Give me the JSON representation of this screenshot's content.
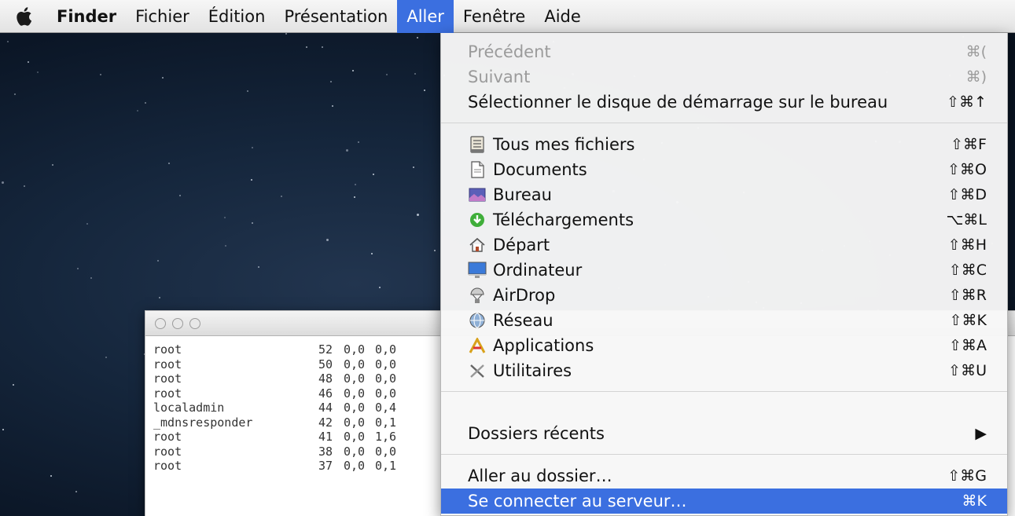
{
  "menubar": {
    "app_name": "Finder",
    "items": [
      "Fichier",
      "Édition",
      "Présentation",
      "Aller",
      "Fenêtre",
      "Aide"
    ],
    "active_item": "Aller"
  },
  "dropdown": {
    "items": [
      {
        "label": "Précédent",
        "shortcut": "⌘(",
        "disabled": true
      },
      {
        "label": "Suivant",
        "shortcut": "⌘)",
        "disabled": true
      },
      {
        "label": "Sélectionner le disque de démarrage sur le bureau",
        "shortcut": "⇧⌘↑",
        "disabled": false
      },
      {
        "label": "Tous mes fichiers",
        "shortcut": "⇧⌘F",
        "icon": "all-files-icon"
      },
      {
        "label": "Documents",
        "shortcut": "⇧⌘O",
        "icon": "document-icon"
      },
      {
        "label": "Bureau",
        "shortcut": "⇧⌘D",
        "icon": "desktop-icon"
      },
      {
        "label": "Téléchargements",
        "shortcut": "⌥⌘L",
        "icon": "download-icon"
      },
      {
        "label": "Départ",
        "shortcut": "⇧⌘H",
        "icon": "home-icon"
      },
      {
        "label": "Ordinateur",
        "shortcut": "⇧⌘C",
        "icon": "computer-icon"
      },
      {
        "label": "AirDrop",
        "shortcut": "⇧⌘R",
        "icon": "airdrop-icon"
      },
      {
        "label": "Réseau",
        "shortcut": "⇧⌘K",
        "icon": "network-icon"
      },
      {
        "label": "Applications",
        "shortcut": "⇧⌘A",
        "icon": "applications-icon"
      },
      {
        "label": "Utilitaires",
        "shortcut": "⇧⌘U",
        "icon": "utilities-icon"
      },
      {
        "label": "Dossiers récents",
        "submenu_arrow": "▶"
      },
      {
        "label": "Aller au dossier…",
        "shortcut": "⇧⌘G"
      },
      {
        "label": "Se connecter au serveur…",
        "shortcut": "⌘K",
        "selected": true
      }
    ]
  },
  "terminal": {
    "rows": [
      {
        "user": "root",
        "pid": "52",
        "cpu": "0,0",
        "mem": "0,0"
      },
      {
        "user": "root",
        "pid": "50",
        "cpu": "0,0",
        "mem": "0,0"
      },
      {
        "user": "root",
        "pid": "48",
        "cpu": "0,0",
        "mem": "0,0"
      },
      {
        "user": "root",
        "pid": "46",
        "cpu": "0,0",
        "mem": "0,0"
      },
      {
        "user": "localadmin",
        "pid": "44",
        "cpu": "0,0",
        "mem": "0,4"
      },
      {
        "user": "_mdnsresponder",
        "pid": "42",
        "cpu": "0,0",
        "mem": "0,1"
      },
      {
        "user": "root",
        "pid": "41",
        "cpu": "0,0",
        "mem": "1,6"
      },
      {
        "user": "root",
        "pid": "38",
        "cpu": "0,0",
        "mem": "0,0"
      },
      {
        "user": "root",
        "pid": "37",
        "cpu": "0,0",
        "mem": "0,1"
      }
    ]
  },
  "colors": {
    "menu_highlight": "#3b6fe0",
    "disabled_text": "#9b9b9b"
  }
}
